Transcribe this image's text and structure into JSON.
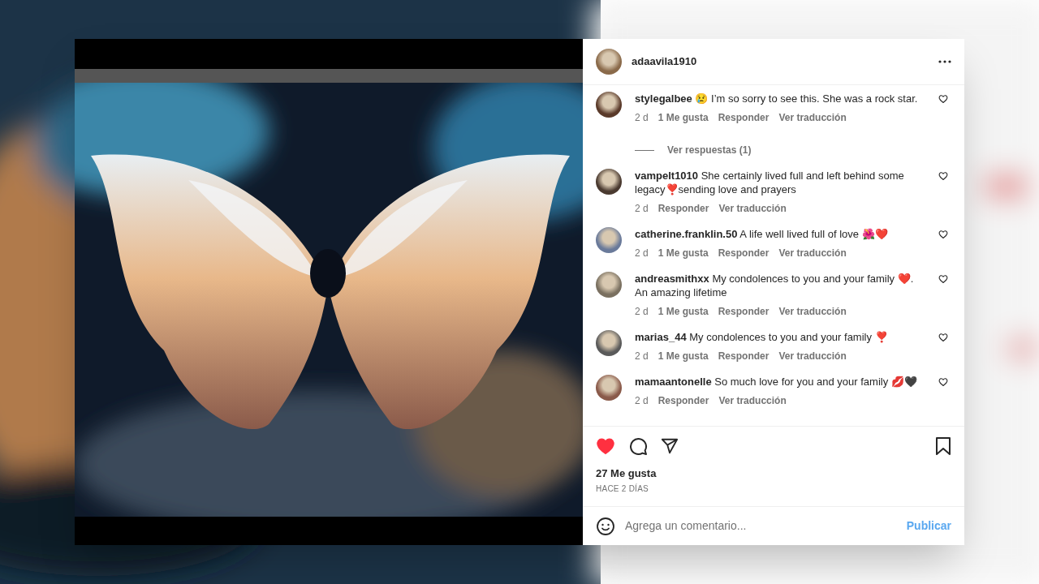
{
  "post": {
    "username": "adaavila1910",
    "comments": [
      {
        "user": "stylegalbee",
        "text": "😢 I’m so sorry to see this. She was a rock star.",
        "time": "2 d",
        "likes": "1 Me gusta",
        "reply": "Responder",
        "translate": "Ver traducción",
        "view_replies": "Ver respuestas (1)",
        "liked": false
      },
      {
        "user": "vampelt1010",
        "text": "She certainly lived full and left behind some legacy❣️sending love and prayers",
        "time": "2 d",
        "reply": "Responder",
        "translate": "Ver traducción",
        "liked": false
      },
      {
        "user": "catherine.franklin.50",
        "text": "A life well lived full of love 🌺❤️",
        "time": "2 d",
        "likes": "1 Me gusta",
        "reply": "Responder",
        "translate": "Ver traducción",
        "liked": false
      },
      {
        "user": "andreasmithxx",
        "text": "My condolences to you and your family ❤️. An amazing lifetime",
        "time": "2 d",
        "likes": "1 Me gusta",
        "reply": "Responder",
        "translate": "Ver traducción",
        "liked": false
      },
      {
        "user": "marias_44",
        "text": "My condolences to you and your family ❣️",
        "time": "2 d",
        "likes": "1 Me gusta",
        "reply": "Responder",
        "translate": "Ver traducción",
        "liked": false
      },
      {
        "user": "mamaantonelle",
        "text": "So much love for you and your family 💋🖤",
        "time": "2 d",
        "reply": "Responder",
        "translate": "Ver traducción",
        "liked": false
      }
    ],
    "liked": true,
    "likes": "27 Me gusta",
    "date": "HACE 2 DÍAS",
    "comment_placeholder": "Agrega un comentario...",
    "publish": "Publicar"
  }
}
